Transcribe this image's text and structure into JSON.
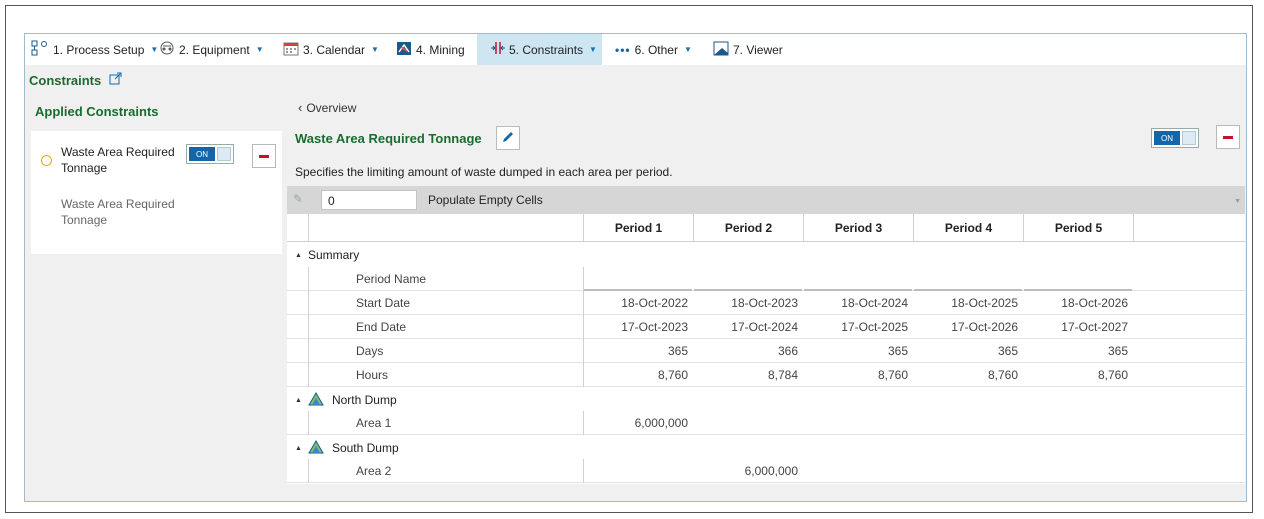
{
  "toolbar": {
    "items": [
      {
        "label": "1. Process Setup",
        "dropdown": true
      },
      {
        "label": "2. Equipment",
        "dropdown": true
      },
      {
        "label": "3. Calendar",
        "dropdown": true
      },
      {
        "label": "4. Mining",
        "dropdown": false
      },
      {
        "label": "5. Constraints",
        "dropdown": true,
        "active": true
      },
      {
        "label": "6. Other",
        "dropdown": true
      },
      {
        "label": "7. Viewer",
        "dropdown": false
      }
    ]
  },
  "page": {
    "title": "Constraints"
  },
  "applied": {
    "title": "Applied Constraints",
    "item_label": "Waste Area Required Tonnage",
    "item_sub": "Waste Area Required Tonnage",
    "toggle_label": "ON"
  },
  "main": {
    "overview_label": "Overview",
    "title": "Waste Area Required Tonnage",
    "toggle_label": "ON",
    "description": "Specifies the limiting amount of waste dumped in each area per period.",
    "populate_value": "0",
    "populate_label": "Populate Empty Cells"
  },
  "grid": {
    "periods": [
      "Period 1",
      "Period 2",
      "Period 3",
      "Period 4",
      "Period 5"
    ],
    "summary_label": "Summary",
    "summary_rows": [
      {
        "label": "Period Name",
        "values": [
          "",
          "",
          "",
          "",
          ""
        ]
      },
      {
        "label": "Start Date",
        "values": [
          "18-Oct-2022",
          "18-Oct-2023",
          "18-Oct-2024",
          "18-Oct-2025",
          "18-Oct-2026"
        ]
      },
      {
        "label": "End Date",
        "values": [
          "17-Oct-2023",
          "17-Oct-2024",
          "17-Oct-2025",
          "17-Oct-2026",
          "17-Oct-2027"
        ]
      },
      {
        "label": "Days",
        "values": [
          "365",
          "366",
          "365",
          "365",
          "365"
        ]
      },
      {
        "label": "Hours",
        "values": [
          "8,760",
          "8,784",
          "8,760",
          "8,760",
          "8,760"
        ]
      }
    ],
    "groups": [
      {
        "label": "North Dump",
        "rows": [
          {
            "label": "Area 1",
            "values": [
              "6,000,000",
              "",
              "",
              "",
              ""
            ]
          }
        ]
      },
      {
        "label": "South Dump",
        "rows": [
          {
            "label": "Area 2",
            "values": [
              "",
              "6,000,000",
              "",
              "",
              ""
            ]
          }
        ]
      }
    ]
  },
  "colors": {
    "accent": "#1466a8",
    "title_green": "#1b6b2e",
    "remove_red": "#c8102e"
  }
}
